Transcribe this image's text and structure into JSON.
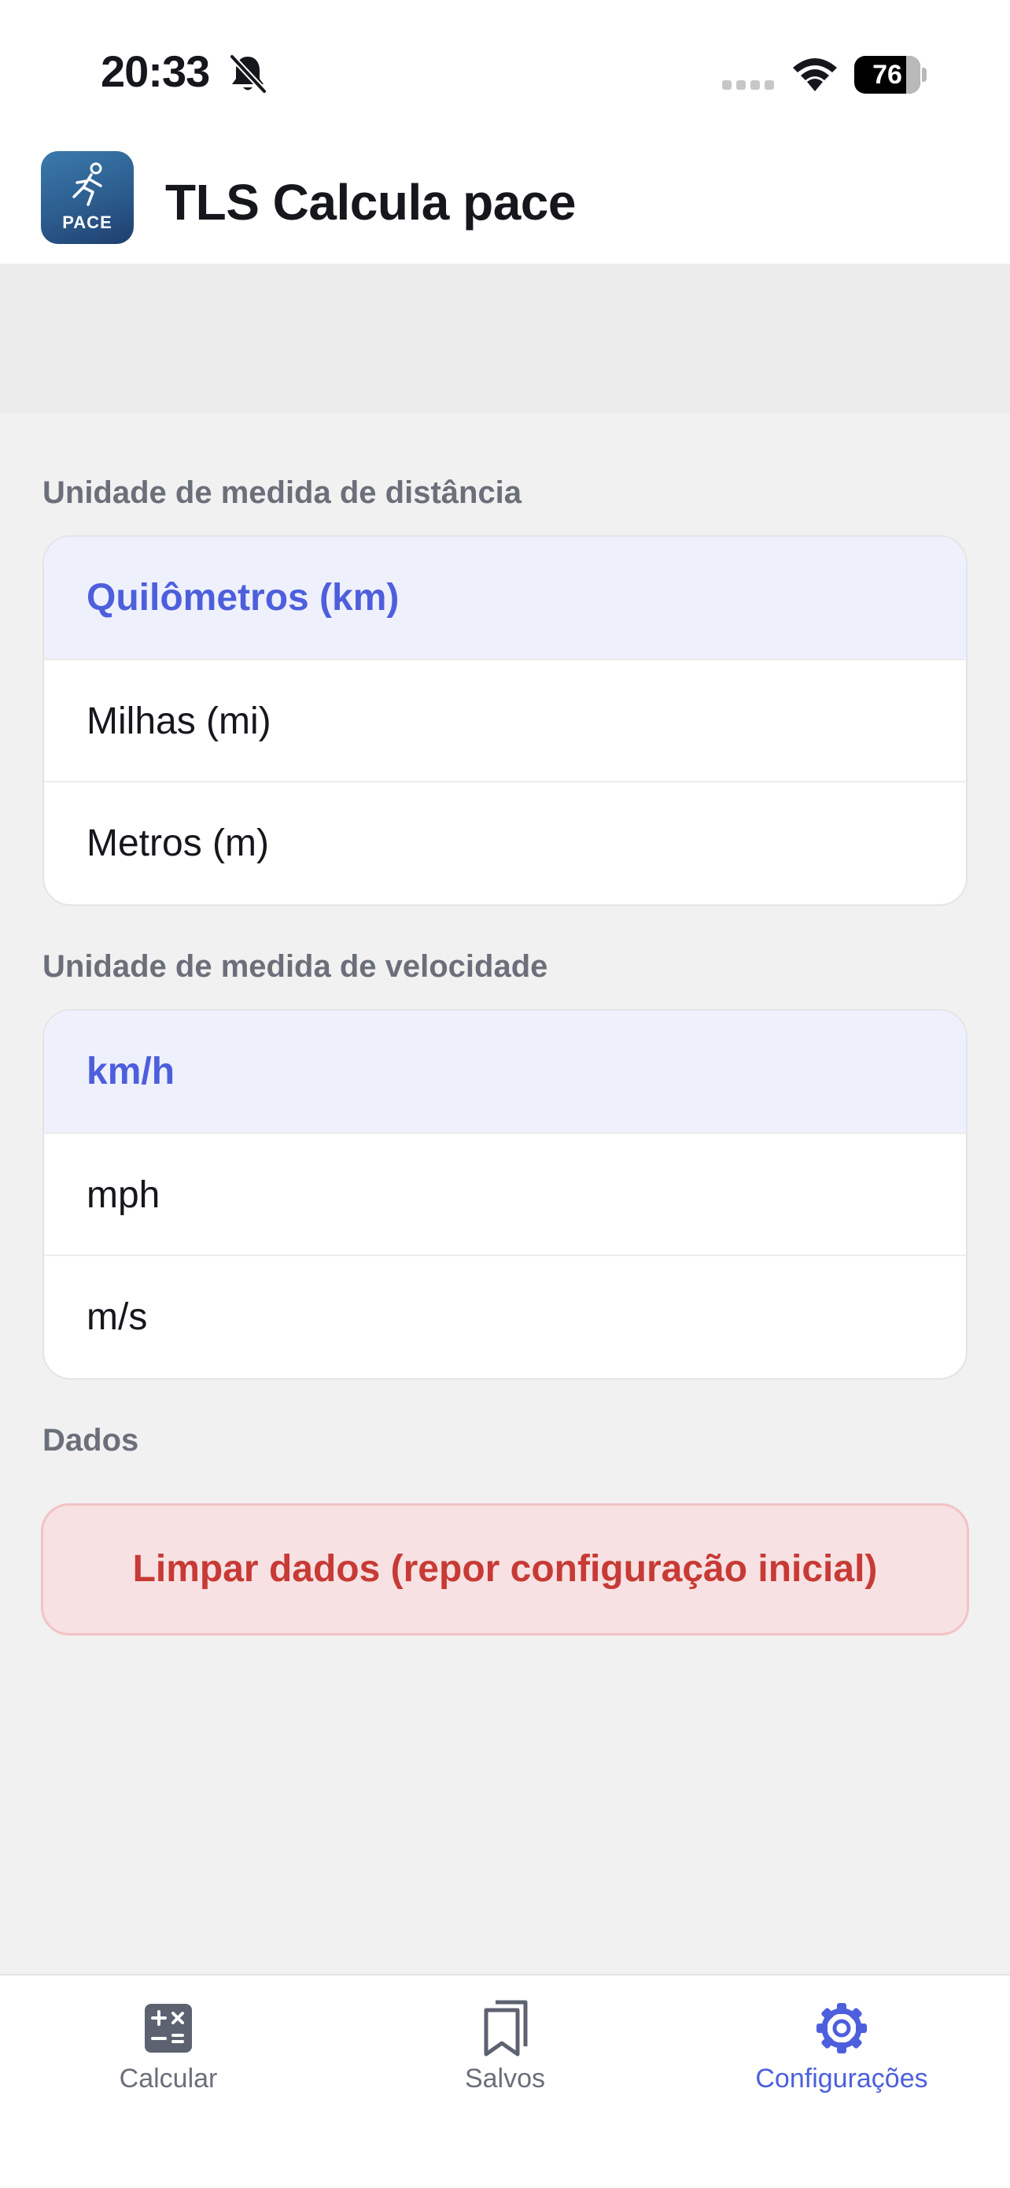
{
  "status_bar": {
    "time": "20:33",
    "battery_level": "76",
    "icons": [
      "bell-slash-icon",
      "cellular-signal-icon",
      "wifi-icon",
      "battery-icon"
    ]
  },
  "header": {
    "logo_text": "PACE",
    "title": "TLS Calcula pace"
  },
  "distance_section": {
    "label": "Unidade de medida de distância",
    "options": [
      {
        "label": "Quilômetros (km)",
        "selected": true
      },
      {
        "label": "Milhas (mi)",
        "selected": false
      },
      {
        "label": "Metros (m)",
        "selected": false
      }
    ]
  },
  "speed_section": {
    "label": "Unidade de medida de velocidade",
    "options": [
      {
        "label": "km/h",
        "selected": true
      },
      {
        "label": "mph",
        "selected": false
      },
      {
        "label": "m/s",
        "selected": false
      }
    ]
  },
  "data_section": {
    "label": "Dados",
    "reset_button": "Limpar dados (repor configuração inicial)"
  },
  "tab_bar": {
    "tabs": [
      {
        "label": "Calcular",
        "icon": "calculator-icon",
        "active": false
      },
      {
        "label": "Salvos",
        "icon": "bookmark-icon",
        "active": false
      },
      {
        "label": "Configurações",
        "icon": "gear-icon",
        "active": true
      }
    ]
  },
  "colors": {
    "accent": "#4d5fdc",
    "selected_bg": "#eef0fc",
    "danger_text": "#c73a35",
    "danger_bg": "#f7e1e2",
    "background": "#f1f1f1"
  }
}
